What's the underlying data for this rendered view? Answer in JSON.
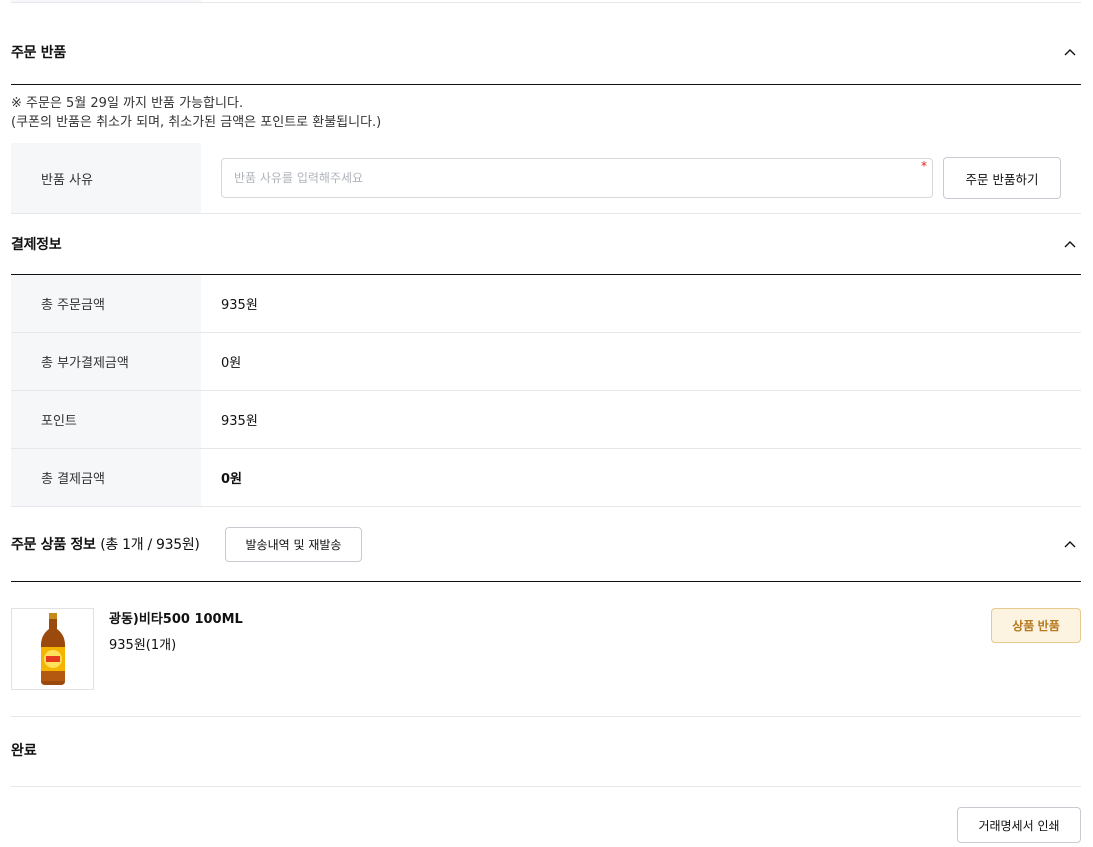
{
  "return_section": {
    "title": "주문 반품",
    "notice_line1": "※ 주문은 5월 29일 까지 반품 가능합니다.",
    "notice_line2": "(쿠폰의 반품은 취소가 되며, 취소가된 금액은 포인트로 환불됩니다.)",
    "reason_label": "반품 사유",
    "reason_placeholder": "반품 사유를 입력해주세요",
    "reason_value": "",
    "required_mark": "*",
    "submit_label": "주문 반품하기"
  },
  "payment_section": {
    "title": "결제정보",
    "rows": [
      {
        "label": "총 주문금액",
        "value": "935원"
      },
      {
        "label": "총 부가결제금액",
        "value": "0원"
      },
      {
        "label": "포인트",
        "value": "935원"
      },
      {
        "label": "총 결제금액",
        "value": "0원"
      }
    ]
  },
  "product_section": {
    "title": "주문 상품 정보",
    "summary": "(총 1개 / 935원)",
    "shipping_button": "발송내역 및 재발송",
    "items": [
      {
        "name": "광동)비타500 100ML",
        "price": "935원(1개)",
        "action": "상품 반품",
        "thumb_icon": "vita500-bottle-image"
      }
    ]
  },
  "status": {
    "label": "완료"
  },
  "footer": {
    "print_button": "거래명세서 인쇄"
  },
  "colors": {
    "accent_bg": "#fdf3e1",
    "accent_text": "#b5791f",
    "accent_border": "#e8c98e",
    "label_bg": "#f6f7f9",
    "required": "#e02020"
  }
}
